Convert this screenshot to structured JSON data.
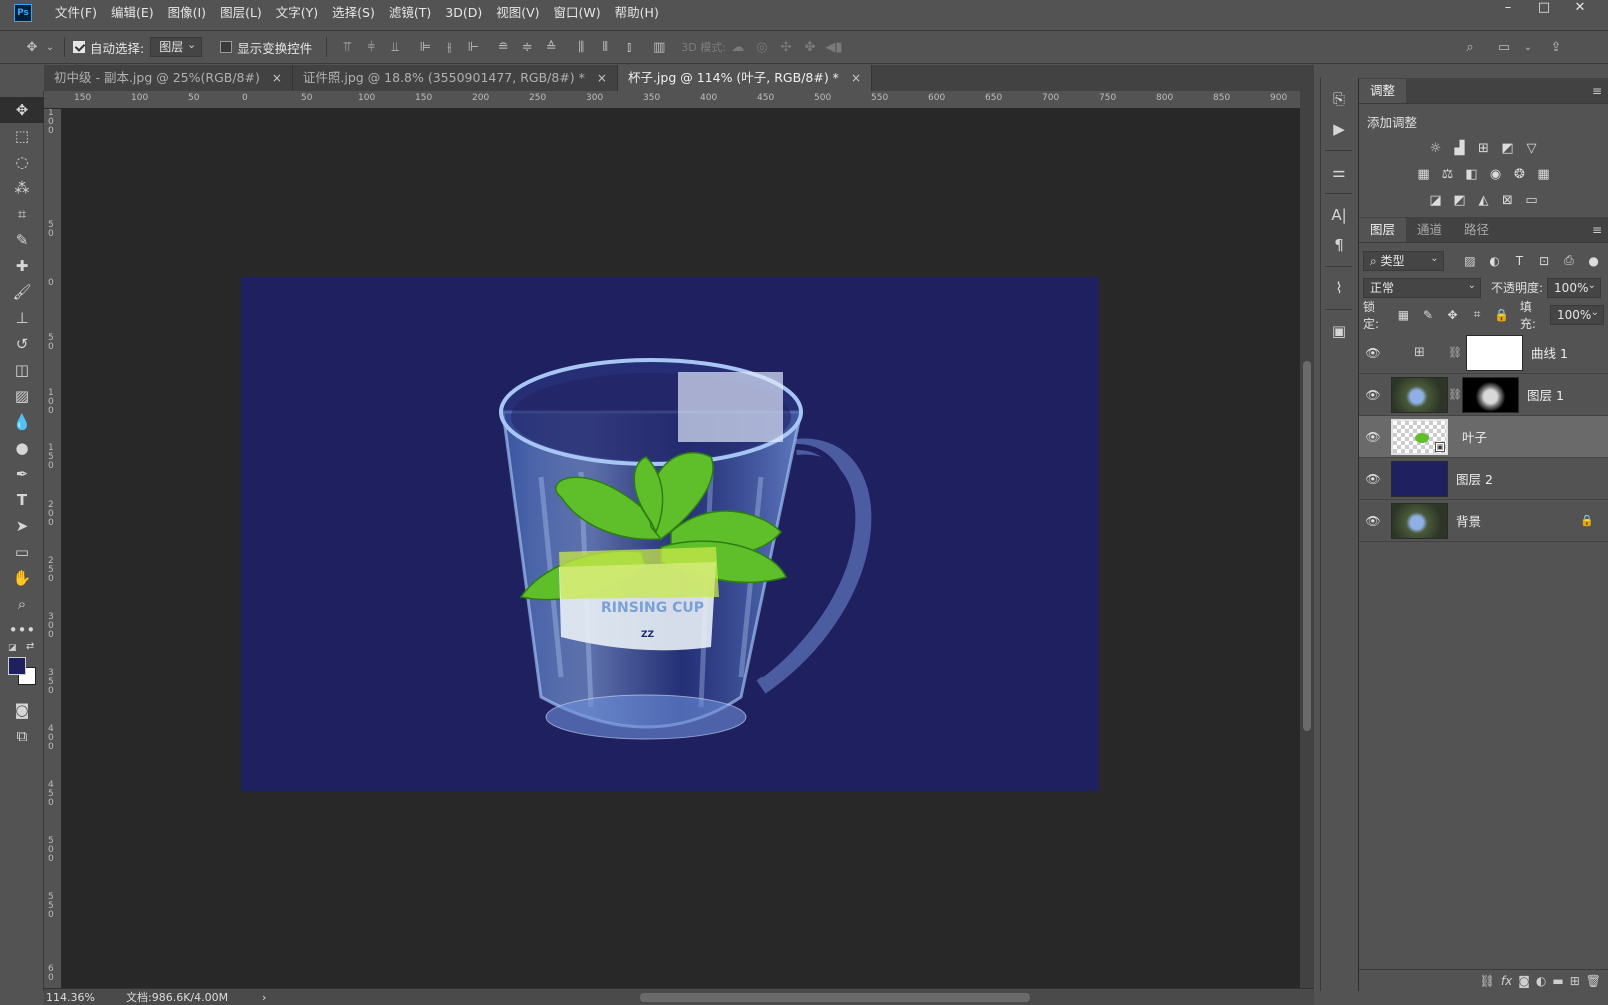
{
  "app": {
    "logo": "Ps"
  },
  "menu": [
    "文件(F)",
    "编辑(E)",
    "图像(I)",
    "图层(L)",
    "文字(Y)",
    "选择(S)",
    "滤镜(T)",
    "3D(D)",
    "视图(V)",
    "窗口(W)",
    "帮助(H)"
  ],
  "window_controls": {
    "minimize": "–",
    "maximize": "□",
    "close": "✕"
  },
  "options": {
    "auto_select_label": "自动选择:",
    "auto_select_checked": true,
    "auto_select_target": "图层",
    "show_transform_label": "显示变换控件",
    "show_transform_checked": false,
    "mode_3d_label": "3D 模式:"
  },
  "tabs": [
    {
      "label": "初中级 - 副本.jpg @ 25%(RGB/8#)",
      "active": false
    },
    {
      "label": "证件照.jpg @ 18.8% (3550901477, RGB/8#) *",
      "active": false
    },
    {
      "label": "杯子.jpg @ 114% (叶子, RGB/8#) *",
      "active": true
    }
  ],
  "ruler_h": [
    "150",
    "100",
    "50",
    "0",
    "50",
    "100",
    "150",
    "200",
    "250",
    "300",
    "350",
    "400",
    "450",
    "500",
    "550",
    "600",
    "650",
    "700",
    "750",
    "800",
    "850",
    "900"
  ],
  "ruler_v": [
    "1 0 0",
    "5 0",
    "0",
    "5 0",
    "1 0 0",
    "1 5 0",
    "2 0 0",
    "2 5 0",
    "3 0 0",
    "3 5 0",
    "4 0 0",
    "4 5 0",
    "5 0 0",
    "5 5 0",
    "6 0"
  ],
  "status": {
    "zoom": "114.36%",
    "doc": "文档:986.6K/4.00M",
    "arrow": "›"
  },
  "colors": {
    "foreground": "#1f2060",
    "background": "#ffffff",
    "document_bg": "#1f2060"
  },
  "adjustments": {
    "tab": "调整",
    "title": "添加调整"
  },
  "layers_panel": {
    "tabs": [
      "图层",
      "通道",
      "路径"
    ],
    "filter_label": "类型",
    "blend_mode": "正常",
    "opacity_label": "不透明度:",
    "opacity": "100%",
    "lock_label": "锁定:",
    "fill_label": "填充:",
    "fill": "100%",
    "layers": [
      {
        "name": "曲线 1",
        "kind": "curves",
        "selected": false
      },
      {
        "name": "图层 1",
        "kind": "masked-photo",
        "selected": false
      },
      {
        "name": "叶子",
        "kind": "smart-leaf",
        "selected": true
      },
      {
        "name": "图层 2",
        "kind": "solid",
        "selected": false
      },
      {
        "name": "背景",
        "kind": "background",
        "selected": false,
        "locked": true
      }
    ]
  }
}
